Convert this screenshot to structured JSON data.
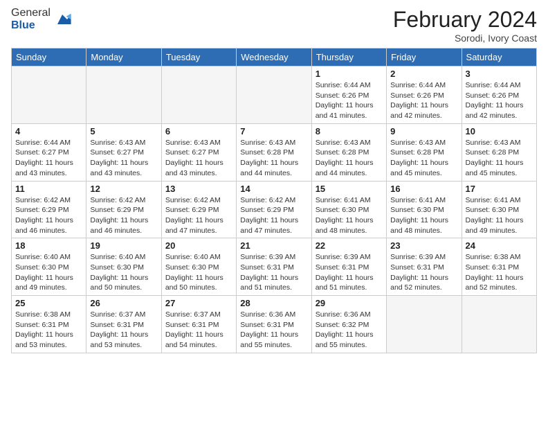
{
  "logo": {
    "general": "General",
    "blue": "Blue"
  },
  "header": {
    "month_title": "February 2024",
    "subtitle": "Sorodi, Ivory Coast"
  },
  "days_of_week": [
    "Sunday",
    "Monday",
    "Tuesday",
    "Wednesday",
    "Thursday",
    "Friday",
    "Saturday"
  ],
  "weeks": [
    [
      {
        "day": "",
        "info": ""
      },
      {
        "day": "",
        "info": ""
      },
      {
        "day": "",
        "info": ""
      },
      {
        "day": "",
        "info": ""
      },
      {
        "day": "1",
        "info": "Sunrise: 6:44 AM\nSunset: 6:26 PM\nDaylight: 11 hours\nand 41 minutes."
      },
      {
        "day": "2",
        "info": "Sunrise: 6:44 AM\nSunset: 6:26 PM\nDaylight: 11 hours\nand 42 minutes."
      },
      {
        "day": "3",
        "info": "Sunrise: 6:44 AM\nSunset: 6:26 PM\nDaylight: 11 hours\nand 42 minutes."
      }
    ],
    [
      {
        "day": "4",
        "info": "Sunrise: 6:44 AM\nSunset: 6:27 PM\nDaylight: 11 hours\nand 43 minutes."
      },
      {
        "day": "5",
        "info": "Sunrise: 6:43 AM\nSunset: 6:27 PM\nDaylight: 11 hours\nand 43 minutes."
      },
      {
        "day": "6",
        "info": "Sunrise: 6:43 AM\nSunset: 6:27 PM\nDaylight: 11 hours\nand 43 minutes."
      },
      {
        "day": "7",
        "info": "Sunrise: 6:43 AM\nSunset: 6:28 PM\nDaylight: 11 hours\nand 44 minutes."
      },
      {
        "day": "8",
        "info": "Sunrise: 6:43 AM\nSunset: 6:28 PM\nDaylight: 11 hours\nand 44 minutes."
      },
      {
        "day": "9",
        "info": "Sunrise: 6:43 AM\nSunset: 6:28 PM\nDaylight: 11 hours\nand 45 minutes."
      },
      {
        "day": "10",
        "info": "Sunrise: 6:43 AM\nSunset: 6:28 PM\nDaylight: 11 hours\nand 45 minutes."
      }
    ],
    [
      {
        "day": "11",
        "info": "Sunrise: 6:42 AM\nSunset: 6:29 PM\nDaylight: 11 hours\nand 46 minutes."
      },
      {
        "day": "12",
        "info": "Sunrise: 6:42 AM\nSunset: 6:29 PM\nDaylight: 11 hours\nand 46 minutes."
      },
      {
        "day": "13",
        "info": "Sunrise: 6:42 AM\nSunset: 6:29 PM\nDaylight: 11 hours\nand 47 minutes."
      },
      {
        "day": "14",
        "info": "Sunrise: 6:42 AM\nSunset: 6:29 PM\nDaylight: 11 hours\nand 47 minutes."
      },
      {
        "day": "15",
        "info": "Sunrise: 6:41 AM\nSunset: 6:30 PM\nDaylight: 11 hours\nand 48 minutes."
      },
      {
        "day": "16",
        "info": "Sunrise: 6:41 AM\nSunset: 6:30 PM\nDaylight: 11 hours\nand 48 minutes."
      },
      {
        "day": "17",
        "info": "Sunrise: 6:41 AM\nSunset: 6:30 PM\nDaylight: 11 hours\nand 49 minutes."
      }
    ],
    [
      {
        "day": "18",
        "info": "Sunrise: 6:40 AM\nSunset: 6:30 PM\nDaylight: 11 hours\nand 49 minutes."
      },
      {
        "day": "19",
        "info": "Sunrise: 6:40 AM\nSunset: 6:30 PM\nDaylight: 11 hours\nand 50 minutes."
      },
      {
        "day": "20",
        "info": "Sunrise: 6:40 AM\nSunset: 6:30 PM\nDaylight: 11 hours\nand 50 minutes."
      },
      {
        "day": "21",
        "info": "Sunrise: 6:39 AM\nSunset: 6:31 PM\nDaylight: 11 hours\nand 51 minutes."
      },
      {
        "day": "22",
        "info": "Sunrise: 6:39 AM\nSunset: 6:31 PM\nDaylight: 11 hours\nand 51 minutes."
      },
      {
        "day": "23",
        "info": "Sunrise: 6:39 AM\nSunset: 6:31 PM\nDaylight: 11 hours\nand 52 minutes."
      },
      {
        "day": "24",
        "info": "Sunrise: 6:38 AM\nSunset: 6:31 PM\nDaylight: 11 hours\nand 52 minutes."
      }
    ],
    [
      {
        "day": "25",
        "info": "Sunrise: 6:38 AM\nSunset: 6:31 PM\nDaylight: 11 hours\nand 53 minutes."
      },
      {
        "day": "26",
        "info": "Sunrise: 6:37 AM\nSunset: 6:31 PM\nDaylight: 11 hours\nand 53 minutes."
      },
      {
        "day": "27",
        "info": "Sunrise: 6:37 AM\nSunset: 6:31 PM\nDaylight: 11 hours\nand 54 minutes."
      },
      {
        "day": "28",
        "info": "Sunrise: 6:36 AM\nSunset: 6:31 PM\nDaylight: 11 hours\nand 55 minutes."
      },
      {
        "day": "29",
        "info": "Sunrise: 6:36 AM\nSunset: 6:32 PM\nDaylight: 11 hours\nand 55 minutes."
      },
      {
        "day": "",
        "info": ""
      },
      {
        "day": "",
        "info": ""
      }
    ]
  ]
}
